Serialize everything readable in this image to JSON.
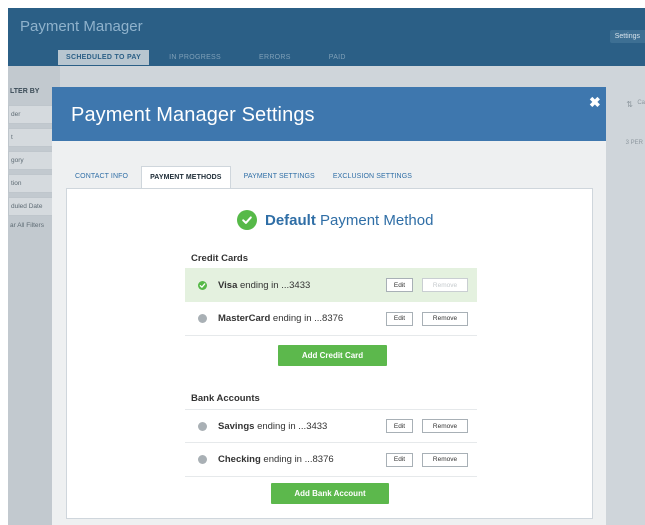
{
  "app": {
    "title": "Payment Manager",
    "tabs": [
      "SCHEDULED TO PAY",
      "IN PROGRESS",
      "ERRORS",
      "PAID"
    ],
    "settings_label": "Settings",
    "filter": {
      "title": "LTER BY",
      "items": [
        "der",
        "t",
        "gory",
        "tion",
        "duled Date"
      ],
      "clear_label": "ar All Filters"
    },
    "right_text": "3 PER",
    "right_text2": "Ca"
  },
  "modal": {
    "title": "Payment Manager Settings",
    "close_symbol": "✖",
    "tabs": [
      "CONTACT INFO",
      "PAYMENT METHODS",
      "PAYMENT SETTINGS",
      "EXCLUSION SETTINGS"
    ],
    "default_heading": {
      "bold": "Default",
      "rest": " Payment Method"
    },
    "credit_cards": {
      "title": "Credit Cards",
      "rows": [
        {
          "name": "Visa",
          "suffix": " ending in ...3433",
          "edit": "Edit",
          "remove": "Remove",
          "selected": true
        },
        {
          "name": "MasterCard",
          "suffix": " ending in ...8376",
          "edit": "Edit",
          "remove": "Remove",
          "selected": false
        }
      ],
      "add_label": "Add Credit Card"
    },
    "bank_accounts": {
      "title": "Bank Accounts",
      "rows": [
        {
          "name": "Savings",
          "suffix": " ending in ...3433",
          "edit": "Edit",
          "remove": "Remove",
          "selected": false
        },
        {
          "name": "Checking",
          "suffix": " ending in ...8376",
          "edit": "Edit",
          "remove": "Remove",
          "selected": false
        }
      ],
      "add_label": "Add Bank Account"
    }
  },
  "colors": {
    "accent_blue": "#3e77ae",
    "success_green": "#5cb84c",
    "selected_row": "#e4f1df"
  }
}
